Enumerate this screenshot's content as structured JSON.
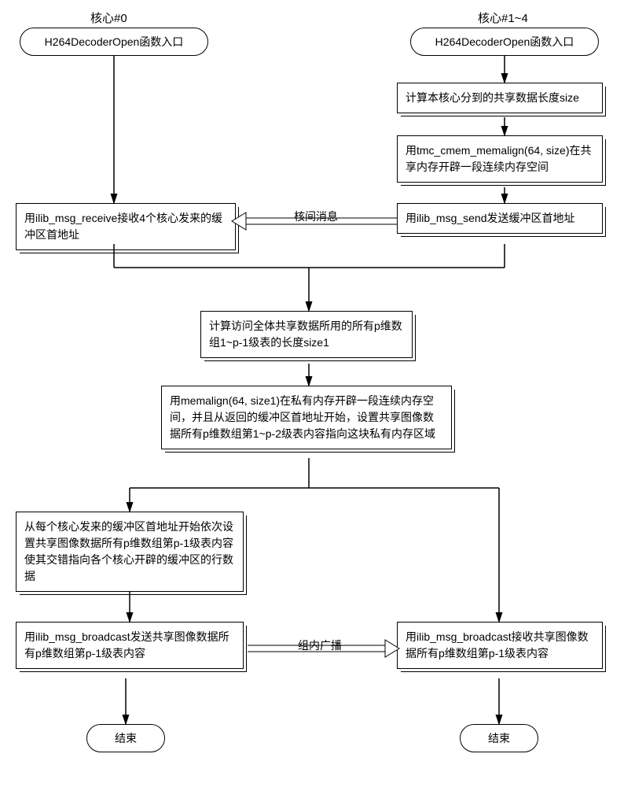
{
  "header": {
    "core0_label": "核心#0",
    "core1_4_label": "核心#1~4"
  },
  "core0": {
    "entry": "H264DecoderOpen函数入口",
    "receive": "用ilib_msg_receive接收4个核心发来的缓冲区首地址",
    "calc_size1": "计算访问全体共享数据所用的所有p维数组1~p-1级表的长度size1",
    "memalign": "用memalign(64, size1)在私有内存开辟一段连续内存空间，并且从返回的缓冲区首地址开始，设置共享图像数据所有p维数组第1~p-2级表内容指向这块私有内存区域",
    "set_interleave": "从每个核心发来的缓冲区首地址开始依次设置共享图像数据所有p维数组第p-1级表内容使其交错指向各个核心开辟的缓冲区的行数据",
    "broadcast_send": "用ilib_msg_broadcast发送共享图像数据所有p维数组第p-1级表内容",
    "end": "结束"
  },
  "core1_4": {
    "entry": "H264DecoderOpen函数入口",
    "calc_size": "计算本核心分到的共享数据长度size",
    "cmem": "用tmc_cmem_memalign(64, size)在共享内存开辟一段连续内存空间",
    "send": "用ilib_msg_send发送缓冲区首地址",
    "broadcast_recv": "用ilib_msg_broadcast接收共享图像数据所有p维数组第p-1级表内容",
    "end": "结束"
  },
  "arrows": {
    "intercore_msg": "核间消息",
    "broadcast": "组内广播"
  }
}
